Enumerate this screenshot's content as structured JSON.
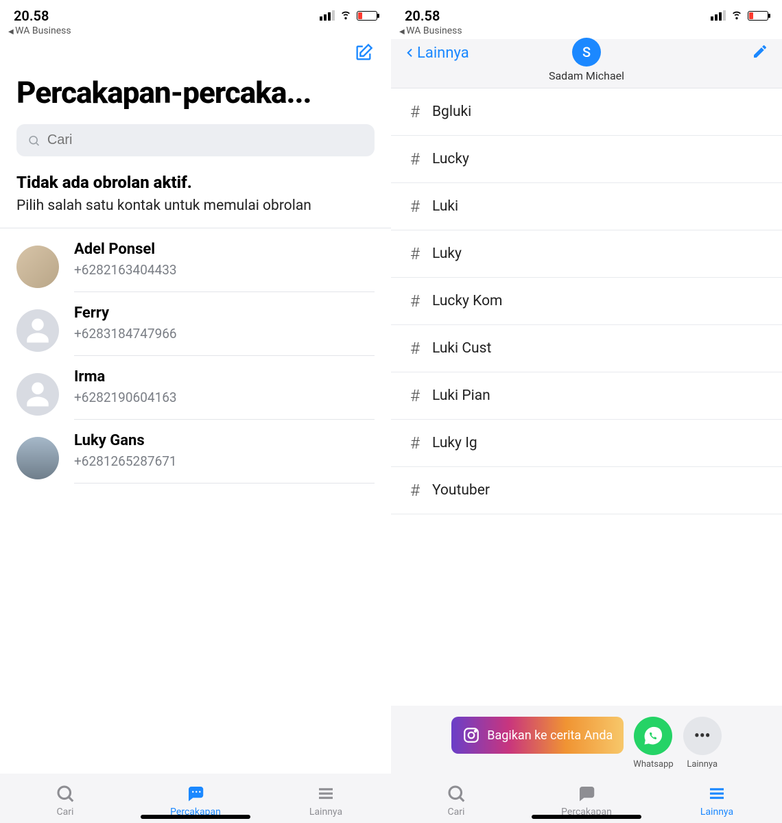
{
  "status": {
    "time": "20.58",
    "back_app": "WA Business"
  },
  "left": {
    "title": "Percakapan-percaka...",
    "search_placeholder": "Cari",
    "empty_title": "Tidak ada obrolan aktif.",
    "empty_sub": "Pilih salah satu kontak untuk memulai obrolan",
    "contacts": [
      {
        "name": "Adel Ponsel",
        "phone": "+6282163404433"
      },
      {
        "name": "Ferry",
        "phone": "+6283184747966"
      },
      {
        "name": "Irma",
        "phone": "+6282190604163"
      },
      {
        "name": "Luky Gans",
        "phone": "+6281265287671"
      }
    ],
    "nav": {
      "cari": "Cari",
      "percakapan": "Percakapan",
      "lainnya": "Lainnya"
    }
  },
  "right": {
    "back_label": "Lainnya",
    "profile_initial": "S",
    "profile_name": "Sadam Michael",
    "tags": [
      "Bgluki",
      "Lucky",
      "Luki",
      "Luky",
      "Lucky Kom",
      "Luki Cust",
      "Luki Pian",
      "Luky Ig",
      "Youtuber"
    ],
    "share": {
      "ig": "Bagikan ke cerita Anda",
      "whatsapp": "Whatsapp",
      "lainnya": "Lainnya"
    },
    "nav": {
      "cari": "Cari",
      "percakapan": "Percakapan",
      "lainnya": "Lainnya"
    }
  }
}
